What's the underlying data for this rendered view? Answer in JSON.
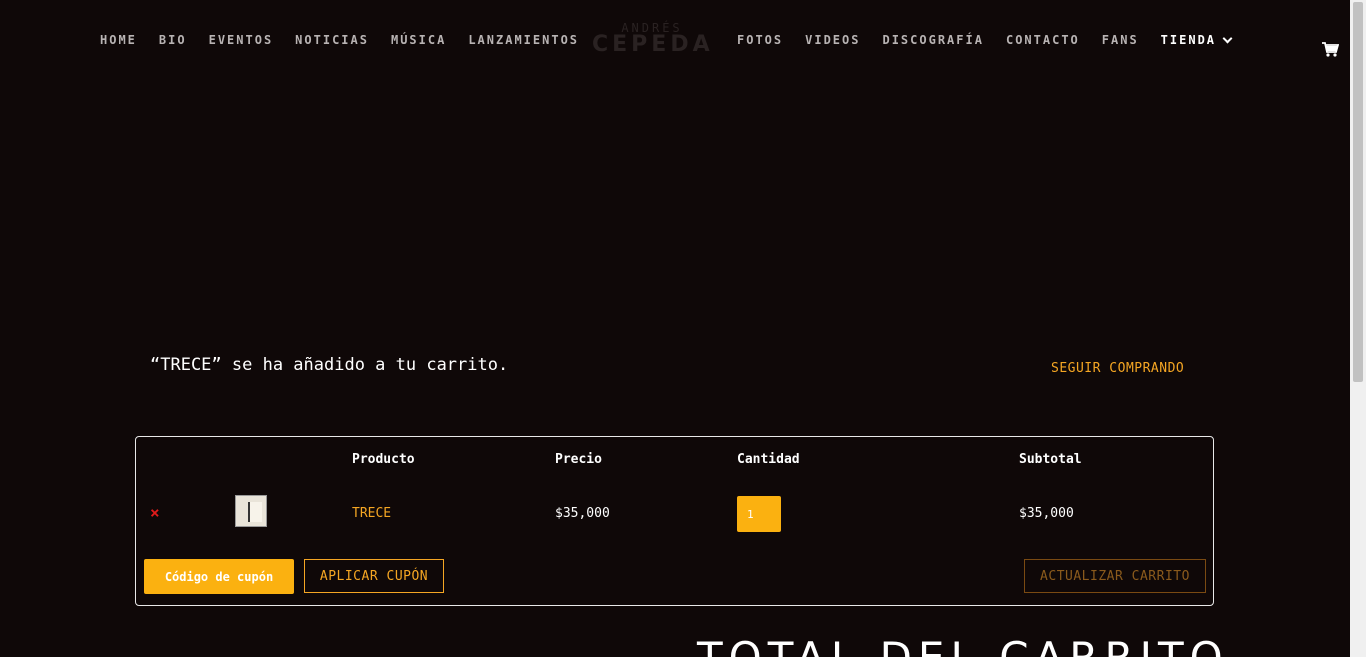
{
  "nav": {
    "left": [
      "HOME",
      "BIO",
      "EVENTOS",
      "NOTICIAS",
      "MÚSICA",
      "LANZAMIENTOS"
    ],
    "right": [
      "FOTOS",
      "VIDEOS",
      "DISCOGRAFÍA",
      "CONTACTO",
      "FANS"
    ],
    "active": "TIENDA"
  },
  "logo": {
    "top": "ANDRÉS",
    "main": "CEPEDA"
  },
  "icons": {
    "cart": "shopping-cart-icon",
    "dropdown": "chevron-down-icon",
    "remove": "close-icon"
  },
  "notice": {
    "message": "“TRECE” se ha añadido a tu carrito.",
    "continue_label": "SEGUIR COMPRANDO"
  },
  "cart": {
    "headers": {
      "product": "Producto",
      "price": "Precio",
      "quantity": "Cantidad",
      "subtotal": "Subtotal"
    },
    "item": {
      "remove": "×",
      "product": "TRECE",
      "price": "$35,000",
      "quantity": "1",
      "subtotal": "$35,000"
    },
    "coupon_placeholder": "Código de cupón",
    "apply_label": "APLICAR CUPÓN",
    "update_label": "ACTUALIZAR CARRITO"
  },
  "totals": {
    "title": "TOTAL DEL CARRITO"
  },
  "colors": {
    "background": "#0f0808",
    "accent": "#f5a623",
    "input": "#fbb110",
    "remove": "#e01b1b"
  }
}
